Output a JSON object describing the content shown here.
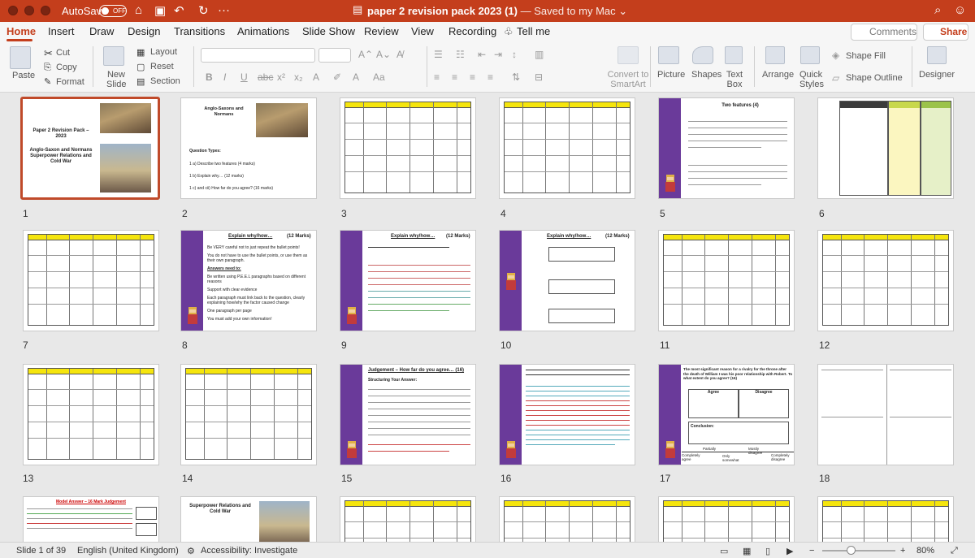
{
  "window": {
    "autosave_label": "AutoSave",
    "autosave_state": "OFF",
    "doc_name": "paper 2 revision pack 2023 (1)",
    "saved_status": " — Saved to my Mac ⌄"
  },
  "tabs": [
    "Home",
    "Insert",
    "Draw",
    "Design",
    "Transitions",
    "Animations",
    "Slide Show",
    "Review",
    "View",
    "Recording",
    "Tell me"
  ],
  "header_buttons": {
    "comments": "Comments",
    "share": "Share"
  },
  "ribbon": {
    "paste": "Paste",
    "cut": "Cut",
    "copy": "Copy",
    "format": "Format",
    "new_slide": "New Slide",
    "layout": "Layout",
    "reset": "Reset",
    "section": "Section",
    "convert_smartart": "Convert to SmartArt",
    "picture": "Picture",
    "shapes": "Shapes",
    "text_box": "Text Box",
    "arrange": "Arrange",
    "quick_styles": "Quick Styles",
    "shape_fill": "Shape Fill",
    "shape_outline": "Shape Outline",
    "designer": "Designer"
  },
  "slides": {
    "s1": {
      "title": "Paper 2 Revision Pack – 2023",
      "subtitle": "Anglo-Saxon and Normans Superpower Relations and Cold War"
    },
    "s2": {
      "title": "Anglo-Saxons and Normans",
      "question_types": "Question Types:",
      "q1": "1 a) Describe two features (4 marks)",
      "q2": "1 b) Explain why… (12 marks)",
      "q3": "1 c) and cii) How far do you agree? (16 marks)"
    },
    "s5": {
      "title": "Two features (4)"
    },
    "s8": {
      "title": "Explain why/how…",
      "marks": "(12 Marks)",
      "bullets": [
        "Be VERY careful not to just repeat the bullet points!",
        "You do not have to use the bullet points, or use them as their own paragraph.",
        "Answers need to:",
        "Be written using P.E.E.L paragraphs based on different reasons",
        "Support with clear evidence",
        "Each paragraph must link back to the question, clearly explaining how/why the factor caused change",
        "One paragraph per page",
        "You must add your own information!"
      ]
    },
    "s9": {
      "title": "Explain why/how…",
      "marks": "(12 Marks)"
    },
    "s10": {
      "title": "Explain why/how…",
      "marks": "(12 Marks)"
    },
    "s15": {
      "title": "Judgement – How far do you agree… (16)",
      "subtitle": "Structuring Your Answer:"
    },
    "s17": {
      "title": "The most significant reason for a rivalry for the throne after the death of William I was his poor relationship with Robert. To what extent do you agree? (16)",
      "agree": "Agree",
      "disagree": "Disagree",
      "conclusion": "Conclusion:",
      "scale": [
        "Completely agree",
        "Partially",
        "Only somewhat",
        "Mostly disagree",
        "Completely disagree"
      ]
    },
    "s19": {
      "title": "Model Answer – 16 Mark Judgement"
    },
    "s20": {
      "title": "Superpower Relations and Cold War"
    }
  },
  "slide_numbers": [
    "1",
    "2",
    "3",
    "4",
    "5",
    "6",
    "7",
    "8",
    "9",
    "10",
    "11",
    "12",
    "13",
    "14",
    "15",
    "16",
    "17",
    "18"
  ],
  "status": {
    "slide_count": "Slide 1 of 39",
    "language": "English (United Kingdom)",
    "accessibility": "Accessibility: Investigate",
    "zoom": "80%"
  },
  "colors": {
    "accent": "#c43e1c",
    "table_header": "#f5e50d",
    "band": "#6a3a9a"
  }
}
